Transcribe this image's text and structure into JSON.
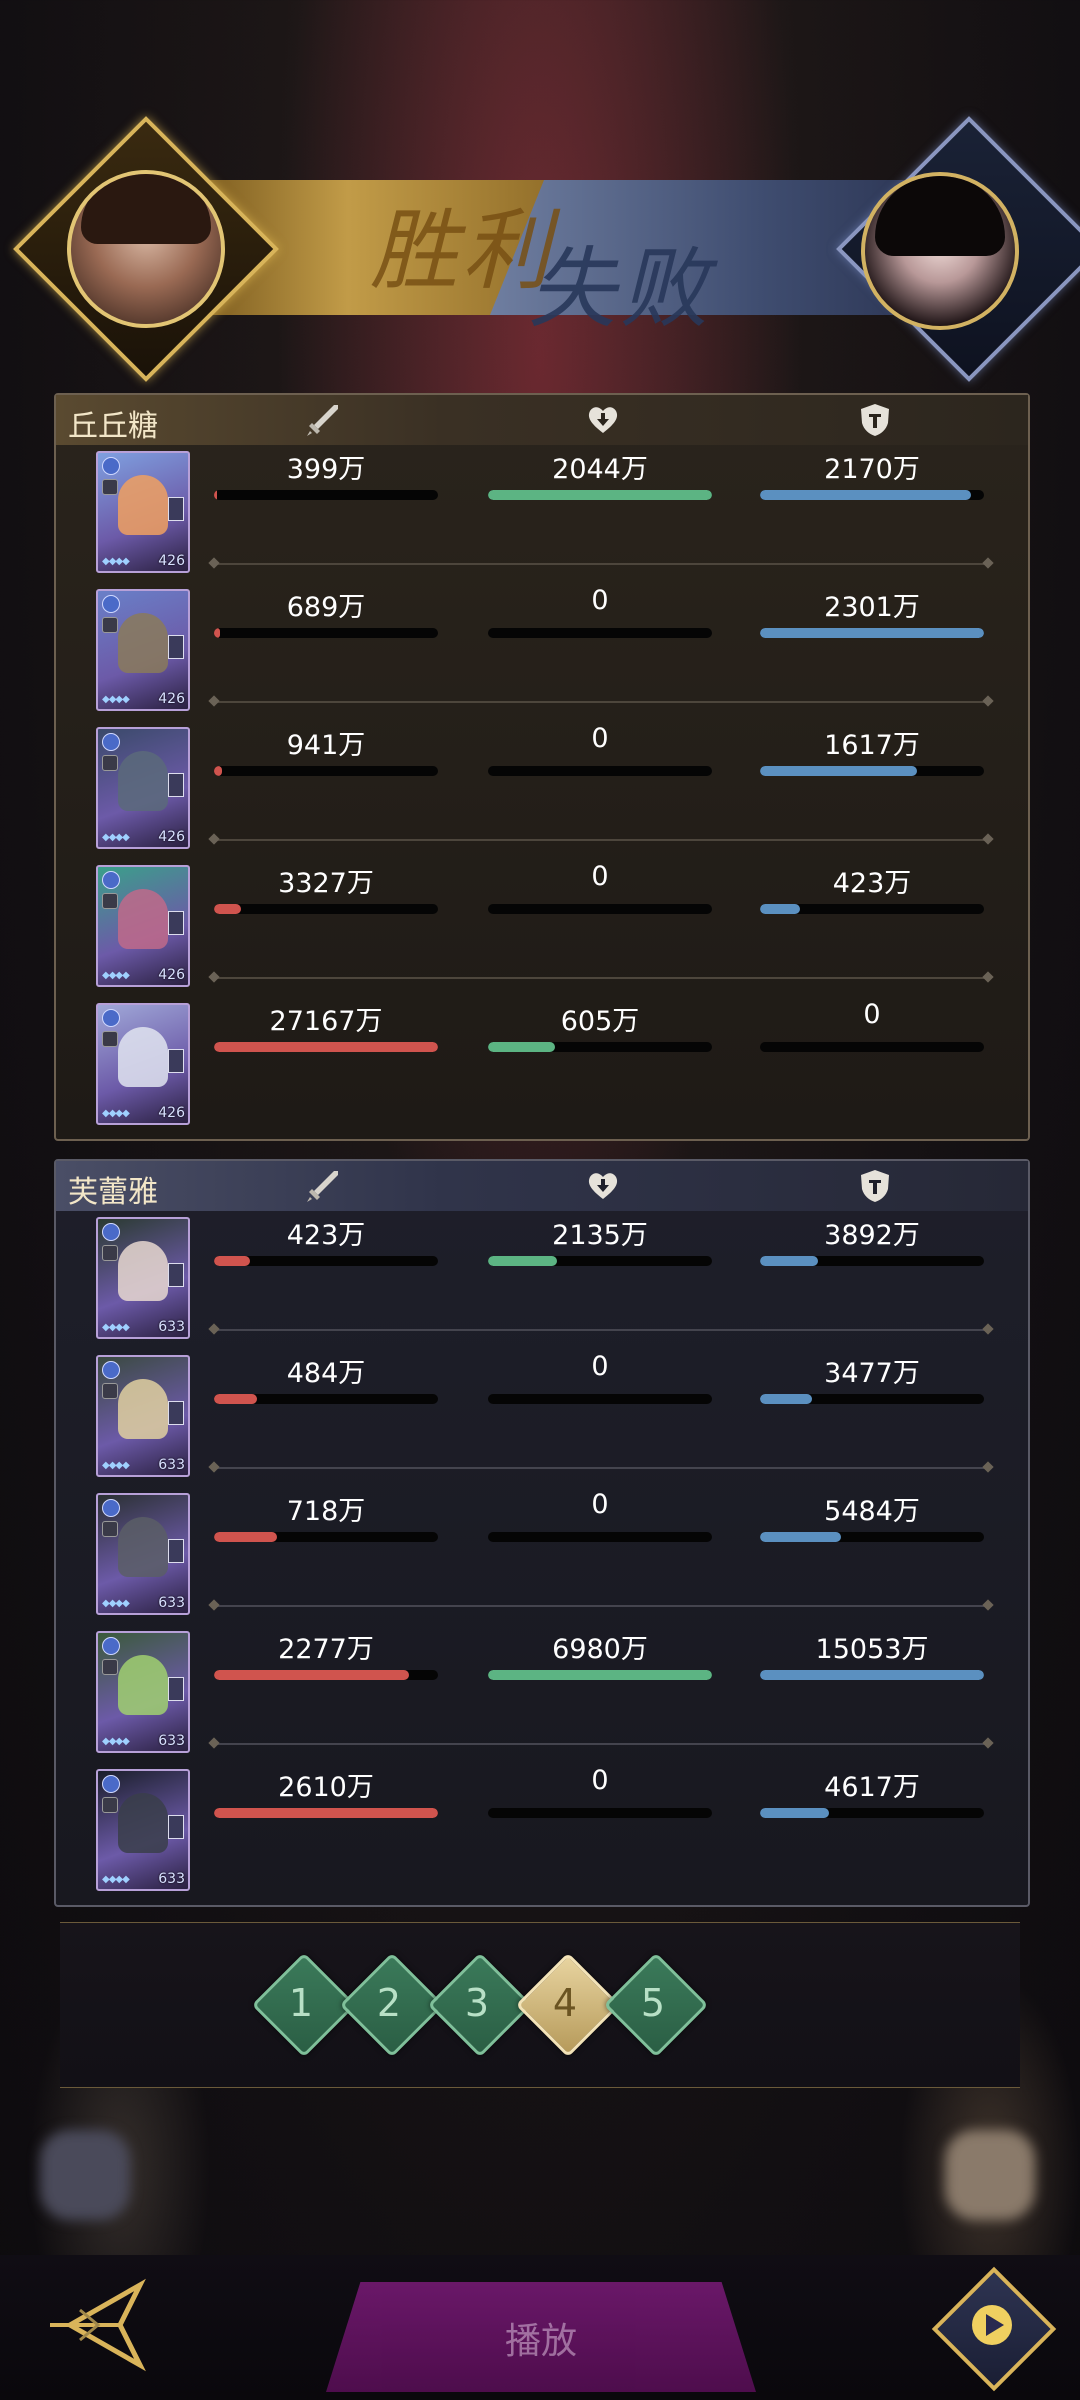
{
  "header": {
    "win_text": "胜利",
    "lose_text": "失败"
  },
  "panels": [
    {
      "player_name": "丘丘糖",
      "rows": [
        {
          "level": "426",
          "damage": "399万",
          "damage_ratio": 0.015,
          "heal": "2044万",
          "heal_ratio": 1.0,
          "tank": "2170万",
          "tank_ratio": 0.94
        },
        {
          "level": "426",
          "damage": "689万",
          "damage_ratio": 0.025,
          "heal": "0",
          "heal_ratio": 0.0,
          "tank": "2301万",
          "tank_ratio": 1.0
        },
        {
          "level": "426",
          "damage": "941万",
          "damage_ratio": 0.035,
          "heal": "0",
          "heal_ratio": 0.0,
          "tank": "1617万",
          "tank_ratio": 0.7
        },
        {
          "level": "426",
          "damage": "3327万",
          "damage_ratio": 0.12,
          "heal": "0",
          "heal_ratio": 0.0,
          "tank": "423万",
          "tank_ratio": 0.18
        },
        {
          "level": "426",
          "damage": "27167万",
          "damage_ratio": 1.0,
          "heal": "605万",
          "heal_ratio": 0.3,
          "tank": "0",
          "tank_ratio": 0.0
        }
      ]
    },
    {
      "player_name": "芙蕾雅",
      "rows": [
        {
          "level": "633",
          "damage": "423万",
          "damage_ratio": 0.16,
          "heal": "2135万",
          "heal_ratio": 0.31,
          "tank": "3892万",
          "tank_ratio": 0.26
        },
        {
          "level": "633",
          "damage": "484万",
          "damage_ratio": 0.19,
          "heal": "0",
          "heal_ratio": 0.0,
          "tank": "3477万",
          "tank_ratio": 0.23
        },
        {
          "level": "633",
          "damage": "718万",
          "damage_ratio": 0.28,
          "heal": "0",
          "heal_ratio": 0.0,
          "tank": "5484万",
          "tank_ratio": 0.36
        },
        {
          "level": "633",
          "damage": "2277万",
          "damage_ratio": 0.87,
          "heal": "6980万",
          "heal_ratio": 1.0,
          "tank": "15053万",
          "tank_ratio": 1.0
        },
        {
          "level": "633",
          "damage": "2610万",
          "damage_ratio": 1.0,
          "heal": "0",
          "heal_ratio": 0.0,
          "tank": "4617万",
          "tank_ratio": 0.31
        }
      ]
    }
  ],
  "rounds": [
    "1",
    "2",
    "3",
    "4",
    "5"
  ],
  "active_round": "4",
  "bottom": {
    "replay_label": "播放"
  },
  "colors": {
    "damage": "#d0544e",
    "heal": "#5cb483",
    "tank": "#5b90c0"
  }
}
